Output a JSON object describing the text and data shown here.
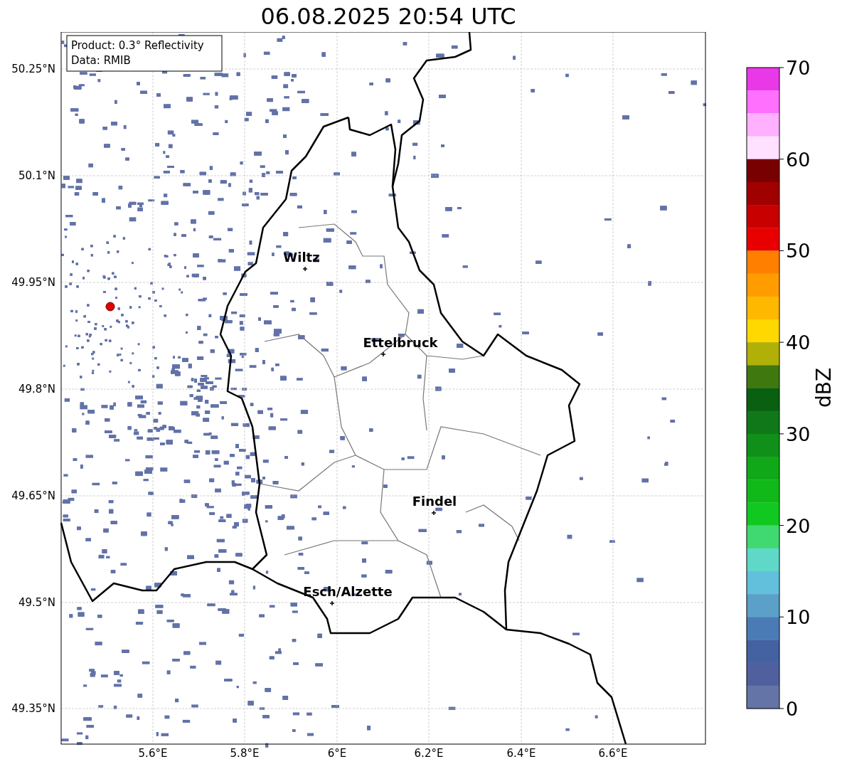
{
  "title": "06.08.2025 20:54 UTC",
  "info_box": [
    "Product: 0.3° Reflectivity",
    "Data: RMIB"
  ],
  "cities": [
    {
      "name": "Wiltz"
    },
    {
      "name": "Ettelbruck"
    },
    {
      "name": "Findel"
    },
    {
      "name": "Esch/Alzette"
    }
  ],
  "y_ticks": [
    "50.25°N",
    "50.1°N",
    "49.95°N",
    "49.8°N",
    "49.65°N",
    "49.5°N",
    "49.35°N"
  ],
  "x_ticks": [
    "5.6°E",
    "5.8°E",
    "6°E",
    "6.2°E",
    "6.4°E",
    "6.6°E"
  ],
  "colorbar": {
    "label": "dBZ",
    "ticks": [
      "70",
      "60",
      "50",
      "40",
      "30",
      "20",
      "10",
      "0"
    ],
    "segments": [
      {
        "color": "#e838e8"
      },
      {
        "color": "#ff70ff"
      },
      {
        "color": "#ffb0ff"
      },
      {
        "color": "#ffe0ff"
      },
      {
        "color": "#780000"
      },
      {
        "color": "#a00000"
      },
      {
        "color": "#c80000"
      },
      {
        "color": "#e80000"
      },
      {
        "color": "#ff8000"
      },
      {
        "color": "#ff9c00"
      },
      {
        "color": "#ffb800"
      },
      {
        "color": "#ffd800"
      },
      {
        "color": "#b0b008"
      },
      {
        "color": "#407810"
      },
      {
        "color": "#086010"
      },
      {
        "color": "#107818"
      },
      {
        "color": "#109018"
      },
      {
        "color": "#10a818"
      },
      {
        "color": "#10b818"
      },
      {
        "color": "#10c820"
      },
      {
        "color": "#40d870"
      },
      {
        "color": "#60d8c8"
      },
      {
        "color": "#62c0dc"
      },
      {
        "color": "#5aa0c8"
      },
      {
        "color": "#4b7bb4"
      },
      {
        "color": "#4462a2"
      },
      {
        "color": "#50609e"
      },
      {
        "color": "#6474a6"
      }
    ]
  }
}
